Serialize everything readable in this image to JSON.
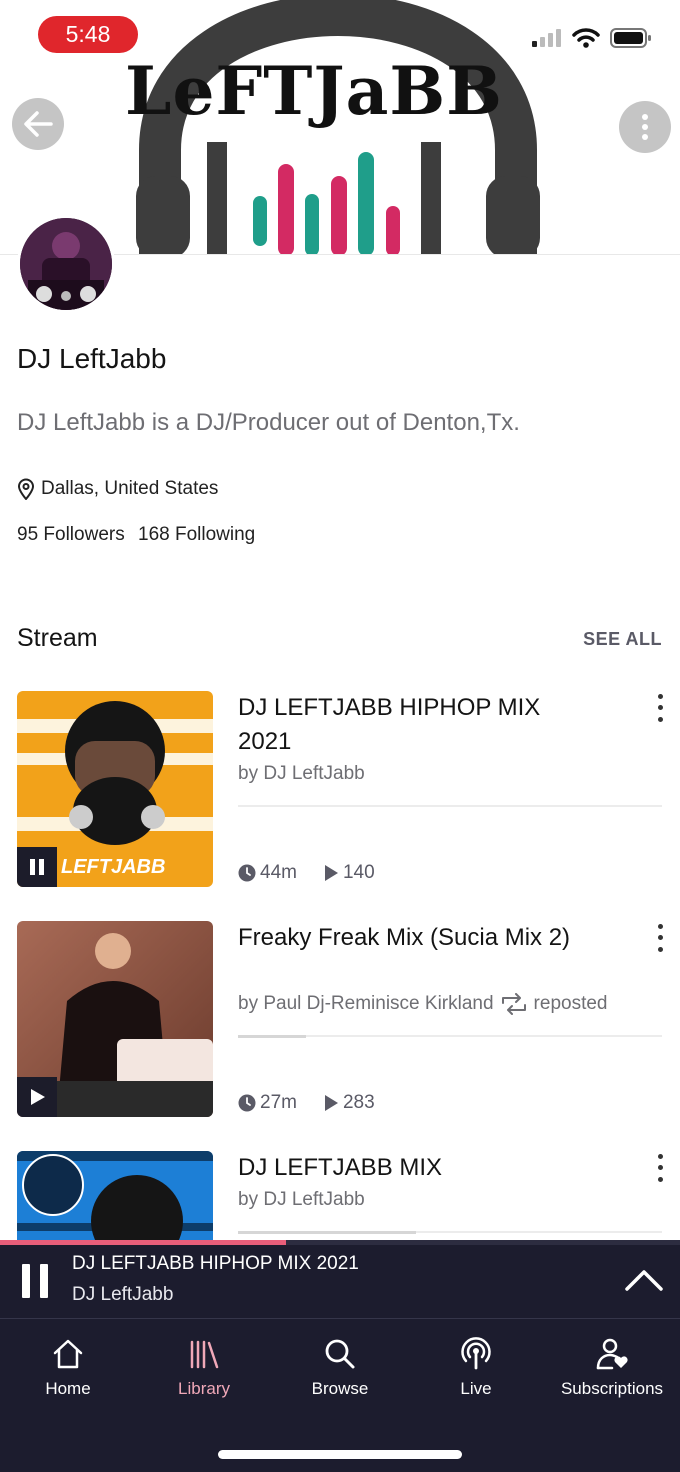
{
  "status_bar": {
    "time": "5:48"
  },
  "banner": {
    "brand": "LeFTJaBB"
  },
  "profile": {
    "name": "DJ LeftJabb",
    "bio": "DJ LeftJabb is a DJ/Producer out of Denton,Tx.",
    "location": "Dallas, United States",
    "followers": "95 Followers",
    "following": "168 Following"
  },
  "stream": {
    "title": "Stream",
    "see_all": "SEE ALL",
    "items": [
      {
        "title": "DJ LEFTJABB HIPHOP MIX 2021",
        "by": "by DJ LeftJabb",
        "duration": "44m",
        "plays": "140",
        "thumb_label": "LEFTJABB",
        "state": "playing",
        "progress": 0
      },
      {
        "title": "Freaky Freak Mix (Sucia Mix 2)",
        "by": "by Paul Dj-Reminisce Kirkland",
        "reposted": "reposted",
        "duration": "27m",
        "plays": "283",
        "state": "paused",
        "progress": 0.16
      },
      {
        "title": "DJ LEFTJABB MIX",
        "by": "by DJ LeftJabb",
        "progress": 0.42
      }
    ]
  },
  "mini_player": {
    "title": "DJ LEFTJABB HIPHOP MIX 2021",
    "artist": "DJ LeftJabb",
    "progress": 0.42
  },
  "tabs": [
    {
      "label": "Home",
      "icon": "home-icon"
    },
    {
      "label": "Library",
      "icon": "library-icon",
      "active": true
    },
    {
      "label": "Browse",
      "icon": "search-icon"
    },
    {
      "label": "Live",
      "icon": "podcast-icon"
    },
    {
      "label": "Subscriptions",
      "icon": "subscriptions-icon"
    }
  ],
  "colors": {
    "accent": "#e85e7a",
    "status_red": "#e0262c",
    "player_bg": "#1c1c2e",
    "thumb_orange": "#f2a21a"
  }
}
